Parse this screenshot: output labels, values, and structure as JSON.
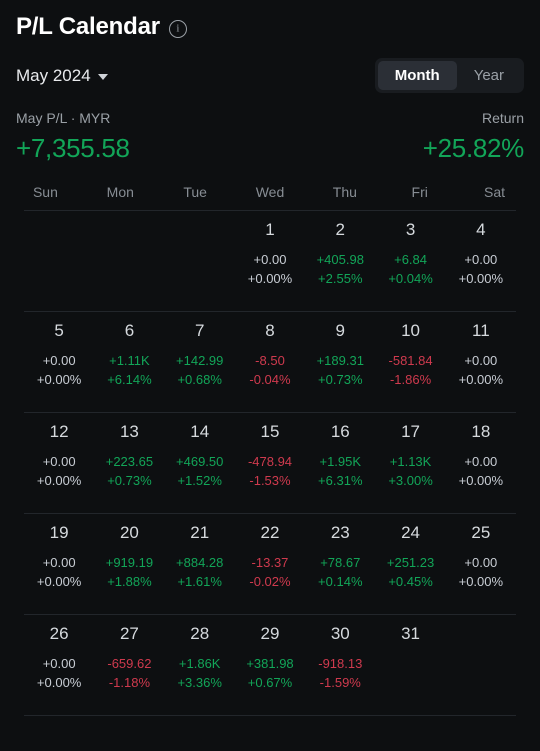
{
  "header": {
    "title": "P/L Calendar",
    "info_icon": "info-circle-icon"
  },
  "controls": {
    "month_label": "May 2024",
    "caret_icon": "chevron-down-icon",
    "toggle": {
      "options": [
        "Month",
        "Year"
      ],
      "selected": "Month"
    }
  },
  "summary": {
    "pl_label": "May P/L · MYR",
    "pl_value": "+7,355.58",
    "return_label": "Return",
    "return_value": "+25.82%"
  },
  "calendar": {
    "weekdays": [
      "Sun",
      "Mon",
      "Tue",
      "Wed",
      "Thu",
      "Fri",
      "Sat"
    ],
    "weeks": [
      [
        {
          "day": "",
          "pl": "",
          "pct": "",
          "tone": "none"
        },
        {
          "day": "",
          "pl": "",
          "pct": "",
          "tone": "none"
        },
        {
          "day": "",
          "pl": "",
          "pct": "",
          "tone": "none"
        },
        {
          "day": "1",
          "pl": "+0.00",
          "pct": "+0.00%",
          "tone": "flat"
        },
        {
          "day": "2",
          "pl": "+405.98",
          "pct": "+2.55%",
          "tone": "pos"
        },
        {
          "day": "3",
          "pl": "+6.84",
          "pct": "+0.04%",
          "tone": "pos"
        },
        {
          "day": "4",
          "pl": "+0.00",
          "pct": "+0.00%",
          "tone": "flat"
        }
      ],
      [
        {
          "day": "5",
          "pl": "+0.00",
          "pct": "+0.00%",
          "tone": "flat"
        },
        {
          "day": "6",
          "pl": "+1.11K",
          "pct": "+6.14%",
          "tone": "pos"
        },
        {
          "day": "7",
          "pl": "+142.99",
          "pct": "+0.68%",
          "tone": "pos"
        },
        {
          "day": "8",
          "pl": "-8.50",
          "pct": "-0.04%",
          "tone": "neg"
        },
        {
          "day": "9",
          "pl": "+189.31",
          "pct": "+0.73%",
          "tone": "pos"
        },
        {
          "day": "10",
          "pl": "-581.84",
          "pct": "-1.86%",
          "tone": "neg"
        },
        {
          "day": "11",
          "pl": "+0.00",
          "pct": "+0.00%",
          "tone": "flat"
        }
      ],
      [
        {
          "day": "12",
          "pl": "+0.00",
          "pct": "+0.00%",
          "tone": "flat"
        },
        {
          "day": "13",
          "pl": "+223.65",
          "pct": "+0.73%",
          "tone": "pos"
        },
        {
          "day": "14",
          "pl": "+469.50",
          "pct": "+1.52%",
          "tone": "pos"
        },
        {
          "day": "15",
          "pl": "-478.94",
          "pct": "-1.53%",
          "tone": "neg"
        },
        {
          "day": "16",
          "pl": "+1.95K",
          "pct": "+6.31%",
          "tone": "pos"
        },
        {
          "day": "17",
          "pl": "+1.13K",
          "pct": "+3.00%",
          "tone": "pos"
        },
        {
          "day": "18",
          "pl": "+0.00",
          "pct": "+0.00%",
          "tone": "flat"
        }
      ],
      [
        {
          "day": "19",
          "pl": "+0.00",
          "pct": "+0.00%",
          "tone": "flat"
        },
        {
          "day": "20",
          "pl": "+919.19",
          "pct": "+1.88%",
          "tone": "pos"
        },
        {
          "day": "21",
          "pl": "+884.28",
          "pct": "+1.61%",
          "tone": "pos"
        },
        {
          "day": "22",
          "pl": "-13.37",
          "pct": "-0.02%",
          "tone": "neg"
        },
        {
          "day": "23",
          "pl": "+78.67",
          "pct": "+0.14%",
          "tone": "pos"
        },
        {
          "day": "24",
          "pl": "+251.23",
          "pct": "+0.45%",
          "tone": "pos"
        },
        {
          "day": "25",
          "pl": "+0.00",
          "pct": "+0.00%",
          "tone": "flat"
        }
      ],
      [
        {
          "day": "26",
          "pl": "+0.00",
          "pct": "+0.00%",
          "tone": "flat"
        },
        {
          "day": "27",
          "pl": "-659.62",
          "pct": "-1.18%",
          "tone": "neg"
        },
        {
          "day": "28",
          "pl": "+1.86K",
          "pct": "+3.36%",
          "tone": "pos"
        },
        {
          "day": "29",
          "pl": "+381.98",
          "pct": "+0.67%",
          "tone": "pos"
        },
        {
          "day": "30",
          "pl": "-918.13",
          "pct": "-1.59%",
          "tone": "neg"
        },
        {
          "day": "31",
          "pl": "",
          "pct": "",
          "tone": "none"
        },
        {
          "day": "",
          "pl": "",
          "pct": "",
          "tone": "none"
        }
      ]
    ]
  },
  "colors": {
    "background": "#0d0f11",
    "positive": "#12a558",
    "negative": "#cf3a4e",
    "neutral": "#c8cdd4",
    "muted": "#9aa0a6",
    "toggle_active_bg": "#2b2f36",
    "toggle_bg": "#191c20",
    "divider": "#22262b"
  }
}
